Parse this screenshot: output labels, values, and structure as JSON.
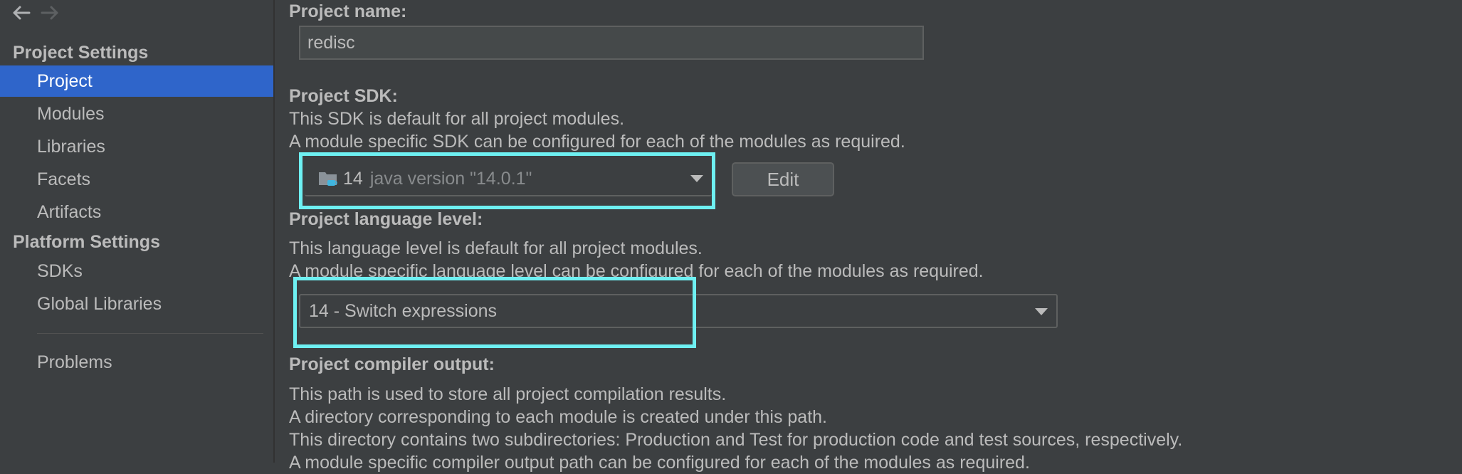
{
  "sidebar": {
    "project_settings_header": "Project Settings",
    "project_items": [
      {
        "label": "Project",
        "selected": true
      },
      {
        "label": "Modules",
        "selected": false
      },
      {
        "label": "Libraries",
        "selected": false
      },
      {
        "label": "Facets",
        "selected": false
      },
      {
        "label": "Artifacts",
        "selected": false
      }
    ],
    "platform_settings_header": "Platform Settings",
    "platform_items": [
      {
        "label": "SDKs"
      },
      {
        "label": "Global Libraries"
      }
    ],
    "problems_label": "Problems"
  },
  "main": {
    "project_name": {
      "label": "Project name:",
      "value": "redisc"
    },
    "project_sdk": {
      "label": "Project SDK:",
      "desc_line1": "This SDK is default for all project modules.",
      "desc_line2": "A module specific SDK can be configured for each of the modules as required.",
      "selected_name": "14",
      "selected_version": "java version \"14.0.1\"",
      "edit_label": "Edit"
    },
    "language_level": {
      "label": "Project language level:",
      "desc_line1": "This language level is default for all project modules.",
      "desc_line2": "A module specific language level can be configured for each of the modules as required.",
      "selected": "14 - Switch expressions"
    },
    "compiler_output": {
      "label": "Project compiler output:",
      "desc_line1": "This path is used to store all project compilation results.",
      "desc_line2": "A directory corresponding to each module is created under this path.",
      "desc_line3": "This directory contains two subdirectories: Production and Test for production code and test sources, respectively.",
      "desc_line4": "A module specific compiler output path can be configured for each of the modules as required."
    }
  },
  "colors": {
    "background": "#3c3f41",
    "selection": "#2f65ca",
    "highlight": "#6ef0f2"
  },
  "icons": {
    "back": "arrow-left-icon",
    "forward": "arrow-right-icon",
    "sdk": "java-folder-icon",
    "dropdown": "chevron-down-icon"
  }
}
